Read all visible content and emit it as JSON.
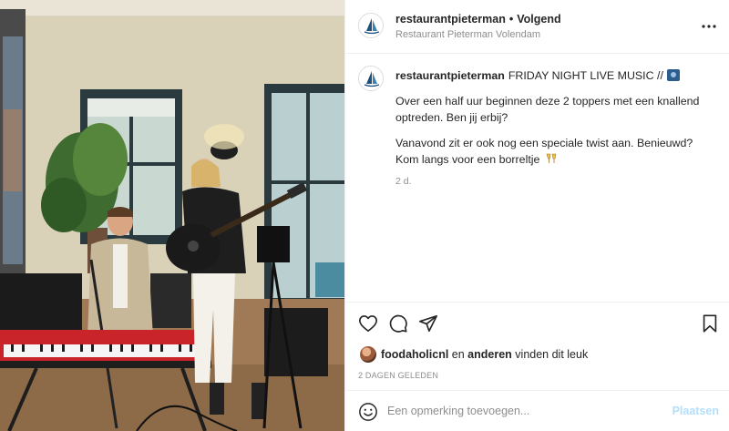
{
  "post": {
    "photo": {
      "description": "Two musicians, a keyboard player and a guitarist, in a restaurant interior"
    }
  },
  "header": {
    "username": "restaurantpieterman",
    "separator": "•",
    "follow_label": "Volgend",
    "location": "Restaurant Pieterman Volendam",
    "more_icon": "more-horizontal-icon"
  },
  "caption": {
    "username": "restaurantpieterman",
    "title": "FRIDAY NIGHT LIVE MUSIC //",
    "paragraph1": "Over een half uur beginnen deze 2 toppers met een knallend optreden. Ben jij erbij?",
    "paragraph2": "Vanavond zit er ook nog een speciale twist aan. Benieuwd? Kom langs voor een borreltje",
    "time": "2 d."
  },
  "actions": {
    "icons": [
      "heart-icon",
      "comment-icon",
      "share-icon",
      "bookmark-icon"
    ],
    "liked_by_user": "foodaholicnl",
    "liked_middle": " en ",
    "liked_others": "anderen",
    "liked_suffix": " vinden dit leuk",
    "date": "2 DAGEN GELEDEN"
  },
  "comment": {
    "placeholder": "Een opmerking toevoegen...",
    "post_label": "Plaatsen",
    "post_color": "#b2dffc"
  },
  "colors": {
    "text": "#262626",
    "secondary": "#8e8e8e",
    "border": "#efefef"
  }
}
